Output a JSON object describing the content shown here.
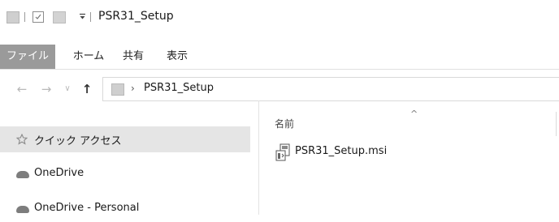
{
  "window": {
    "title": "PSR31_Setup",
    "quick_access_icons": [
      "folder-icon",
      "properties-icon",
      "new-folder-icon",
      "customize-dropdown-icon"
    ]
  },
  "ribbon": {
    "tabs": [
      {
        "label": "ファイル",
        "active": true
      },
      {
        "label": "ホーム"
      },
      {
        "label": "共有"
      },
      {
        "label": "表示"
      }
    ]
  },
  "address_bar": {
    "nav_icons": [
      "back-arrow-icon",
      "forward-arrow-icon",
      "recent-locations-icon",
      "up-arrow-icon"
    ],
    "chevron": "›",
    "breadcrumb": "PSR31_Setup"
  },
  "nav_pane": {
    "items": [
      {
        "label": "クイック アクセス",
        "icon": "star-icon",
        "selected": true
      },
      {
        "label": "OneDrive",
        "icon": "cloud-icon"
      },
      {
        "label": "OneDrive - Personal",
        "icon": "cloud-icon"
      }
    ]
  },
  "content": {
    "column_header": "名前",
    "sort_indicator": "^",
    "files": [
      {
        "name": "PSR31_Setup.msi",
        "icon": "msi-installer-icon"
      }
    ]
  },
  "colors": {
    "file_tab_bg": "#9a9a9a",
    "selected_item_bg": "#e5e5e5"
  }
}
